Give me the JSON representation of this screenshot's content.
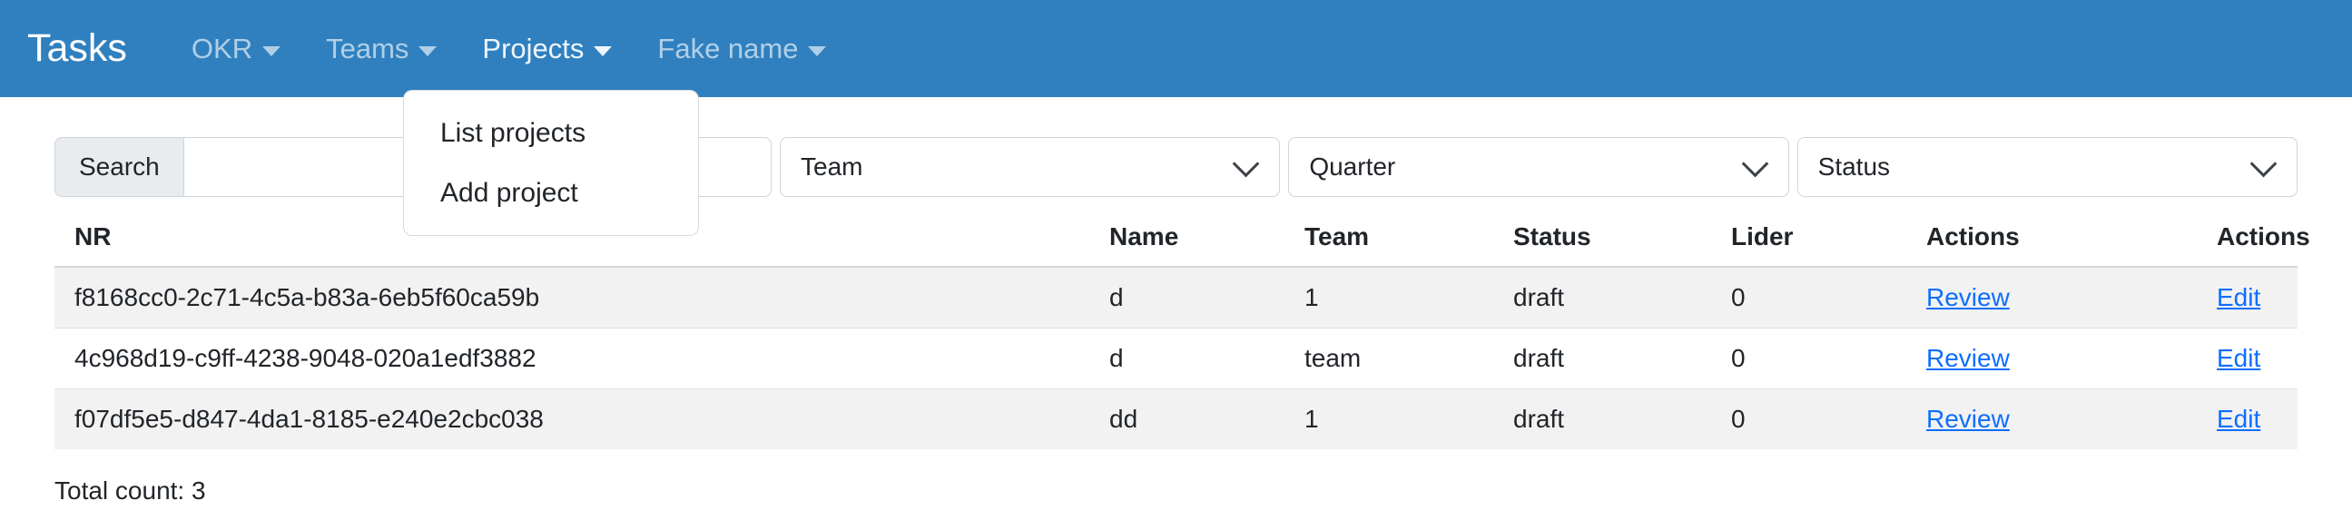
{
  "navbar": {
    "brand": "Tasks",
    "background_color": "#3080bf",
    "items": [
      {
        "label": "OKR",
        "caret_icon": "caret-down-icon",
        "active": false
      },
      {
        "label": "Teams",
        "caret_icon": "caret-down-icon",
        "active": false
      },
      {
        "label": "Projects",
        "caret_icon": "caret-down-icon",
        "active": true
      },
      {
        "label": "Fake name",
        "caret_icon": "caret-down-icon",
        "active": false
      }
    ]
  },
  "dropdown": {
    "open_for": "Projects",
    "items": [
      {
        "label": "List projects"
      },
      {
        "label": "Add project"
      }
    ]
  },
  "filters": {
    "search_button_label": "Search",
    "search_input_value": "",
    "search_input_placeholder": "",
    "selects": [
      {
        "name": "team",
        "selected": "Team",
        "chevron_icon": "chevron-down-icon"
      },
      {
        "name": "quarter",
        "selected": "Quarter",
        "chevron_icon": "chevron-down-icon"
      },
      {
        "name": "status",
        "selected": "Status",
        "chevron_icon": "chevron-down-icon"
      }
    ]
  },
  "table": {
    "headers": [
      "NR",
      "Name",
      "Team",
      "Status",
      "Lider",
      "Actions",
      "Actions"
    ],
    "rows": [
      {
        "nr": "f8168cc0-2c71-4c5a-b83a-6eb5f60ca59b",
        "name": "d",
        "team": "1",
        "status": "draft",
        "lider": "0",
        "action1": "Review",
        "action2": "Edit"
      },
      {
        "nr": "4c968d19-c9ff-4238-9048-020a1edf3882",
        "name": "d",
        "team": "team",
        "status": "draft",
        "lider": "0",
        "action1": "Review",
        "action2": "Edit"
      },
      {
        "nr": "f07df5e5-d847-4da1-8185-e240e2cbc038",
        "name": "dd",
        "team": "1",
        "status": "draft",
        "lider": "0",
        "action1": "Review",
        "action2": "Edit"
      }
    ]
  },
  "footer": {
    "total_count": "Total count: 3"
  },
  "colors": {
    "navbar": "#3080bf",
    "link": "#0d6efd",
    "row_stripe": "#f2f2f2",
    "button_bg": "#e9ecef"
  }
}
